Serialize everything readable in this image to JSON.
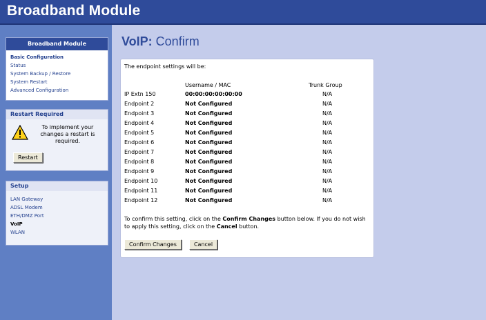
{
  "header": {
    "title": "Broadband Module"
  },
  "sidebar": {
    "main_box": {
      "title": "Broadband Module",
      "items": [
        {
          "label": "Basic Configuration"
        },
        {
          "label": "Status"
        },
        {
          "label": "System Backup / Restore"
        },
        {
          "label": "System Restart"
        },
        {
          "label": "Advanced Configuration"
        }
      ]
    },
    "restart_box": {
      "title": "Restart Required",
      "message": "To implement your changes a restart is required.",
      "button": "Restart"
    },
    "setup_box": {
      "title": "Setup",
      "items": [
        {
          "label": "LAN Gateway"
        },
        {
          "label": "ADSL Modem"
        },
        {
          "label": "ETH/DMZ Port"
        },
        {
          "label": "VoIP"
        },
        {
          "label": "WLAN"
        }
      ]
    }
  },
  "main": {
    "title_bold": "VoIP:",
    "title_rest": " Confirm",
    "intro": "The endpoint settings will be:",
    "columns": {
      "username": "Username / MAC",
      "trunk": "Trunk Group"
    },
    "rows": [
      {
        "endpoint": "IP Extn 150",
        "username": "00:00:00:00:00:00",
        "trunk": "N/A"
      },
      {
        "endpoint": "Endpoint 2",
        "username": "Not Configured",
        "trunk": "N/A"
      },
      {
        "endpoint": "Endpoint 3",
        "username": "Not Configured",
        "trunk": "N/A"
      },
      {
        "endpoint": "Endpoint 4",
        "username": "Not Configured",
        "trunk": "N/A"
      },
      {
        "endpoint": "Endpoint 5",
        "username": "Not Configured",
        "trunk": "N/A"
      },
      {
        "endpoint": "Endpoint 6",
        "username": "Not Configured",
        "trunk": "N/A"
      },
      {
        "endpoint": "Endpoint 7",
        "username": "Not Configured",
        "trunk": "N/A"
      },
      {
        "endpoint": "Endpoint 8",
        "username": "Not Configured",
        "trunk": "N/A"
      },
      {
        "endpoint": "Endpoint 9",
        "username": "Not Configured",
        "trunk": "N/A"
      },
      {
        "endpoint": "Endpoint 10",
        "username": "Not Configured",
        "trunk": "N/A"
      },
      {
        "endpoint": "Endpoint 11",
        "username": "Not Configured",
        "trunk": "N/A"
      },
      {
        "endpoint": "Endpoint 12",
        "username": "Not Configured",
        "trunk": "N/A"
      }
    ],
    "confirm": {
      "text1": "To confirm this setting, click on the ",
      "bold1": "Confirm Changes",
      "text2": " button below. If you do not wish to apply this setting, click on the ",
      "bold2": "Cancel",
      "text3": " button."
    },
    "buttons": {
      "confirm": "Confirm Changes",
      "cancel": "Cancel"
    }
  },
  "colors": {
    "header_bg": "#2f4b9a",
    "sidebar_bg": "#5f7fc4",
    "main_bg": "#c4cceb",
    "link": "#23408e"
  },
  "icons": {
    "warning": "warning-triangle-icon"
  }
}
